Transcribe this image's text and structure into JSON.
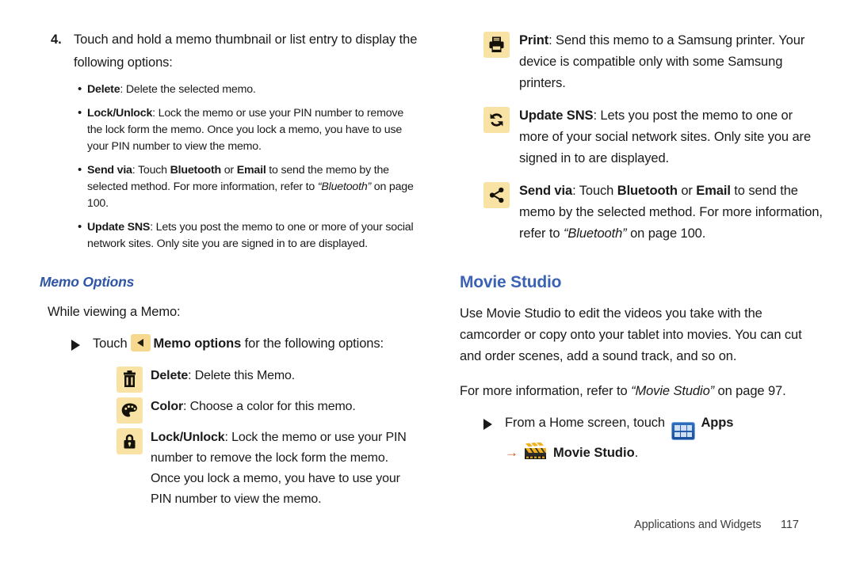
{
  "left_column": {
    "step": {
      "number": "4.",
      "text": "Touch and hold a memo thumbnail or list entry to display the following options:"
    },
    "bullets": [
      {
        "term": "Delete",
        "rest": ": Delete the selected memo."
      },
      {
        "term": "Lock/Unlock",
        "rest": ": Lock the memo or use your PIN number to remove the lock form the memo. Once you lock a memo, you have to use your PIN number to view the memo."
      },
      {
        "term": "Send via",
        "rest_a": ": Touch ",
        "bold_a": "Bluetooth",
        "rest_b": " or ",
        "bold_b": "Email",
        "rest_c": " to send the memo by the selected method. For more information, refer to ",
        "italic": "“Bluetooth”",
        "rest_d": " on page 100."
      },
      {
        "term": "Update SNS",
        "rest": ": Lets you post the memo to one or more of your social network sites. Only site you are signed in to are displayed."
      }
    ],
    "section_heading": "Memo Options",
    "intro": "While viewing a Memo:",
    "touch_line": {
      "prefix": "Touch",
      "icon": "memo-options-icon",
      "bold": "Memo options",
      "suffix": "for the following options:"
    },
    "icon_items": [
      {
        "icon": "trash-icon",
        "term": "Delete",
        "rest": ": Delete this Memo."
      },
      {
        "icon": "palette-icon",
        "term": "Color",
        "rest": ": Choose a color for this memo."
      },
      {
        "icon": "lock-icon",
        "term": "Lock/Unlock",
        "rest": ": Lock the memo or use your PIN number to remove the lock form the memo. Once you lock a memo, you have to use your PIN number to view the memo."
      }
    ]
  },
  "right_column": {
    "icon_items": [
      {
        "icon": "printer-icon",
        "term": "Print",
        "rest": ": Send this memo to a Samsung printer. Your device is compatible only with some Samsung printers."
      },
      {
        "icon": "sync-icon",
        "term": "Update SNS",
        "rest": ": Lets you post the memo to one or more of your social network sites. Only site you are signed in to are displayed."
      }
    ],
    "send_via": {
      "icon": "share-icon",
      "term": "Send via",
      "rest_a": ": Touch ",
      "bold_a": "Bluetooth",
      "rest_b": " or ",
      "bold_b": "Email",
      "rest_c": " to send the memo by the selected method. For more information, refer to ",
      "italic": "“Bluetooth”",
      "rest_d": " on page 100."
    },
    "heading": "Movie Studio",
    "paragraph": "Use Movie Studio to edit the videos you take with the camcorder or copy onto your tablet into movies. You can cut and order scenes, add a sound track, and so on.",
    "ref_line": {
      "prefix": "For more information, refer to ",
      "italic": "“Movie Studio”",
      "suffix": " on page 97."
    },
    "home_line": {
      "prefix": "From a Home screen, touch",
      "apps_icon": "apps-icon",
      "apps_label": "Apps"
    },
    "sub_line": {
      "arrow": "→",
      "clap_icon": "movie-studio-icon",
      "label": "Movie Studio",
      "period": "."
    }
  },
  "footer": {
    "title": "Applications and Widgets",
    "page_number": "117"
  },
  "colors": {
    "heading_blue": "#3c62b4",
    "subheading_blue": "#2f55a4",
    "icon_bg": "#f8e2a4",
    "apps_blue": "#2f6fc0",
    "arrow_orange": "#c8560f"
  }
}
